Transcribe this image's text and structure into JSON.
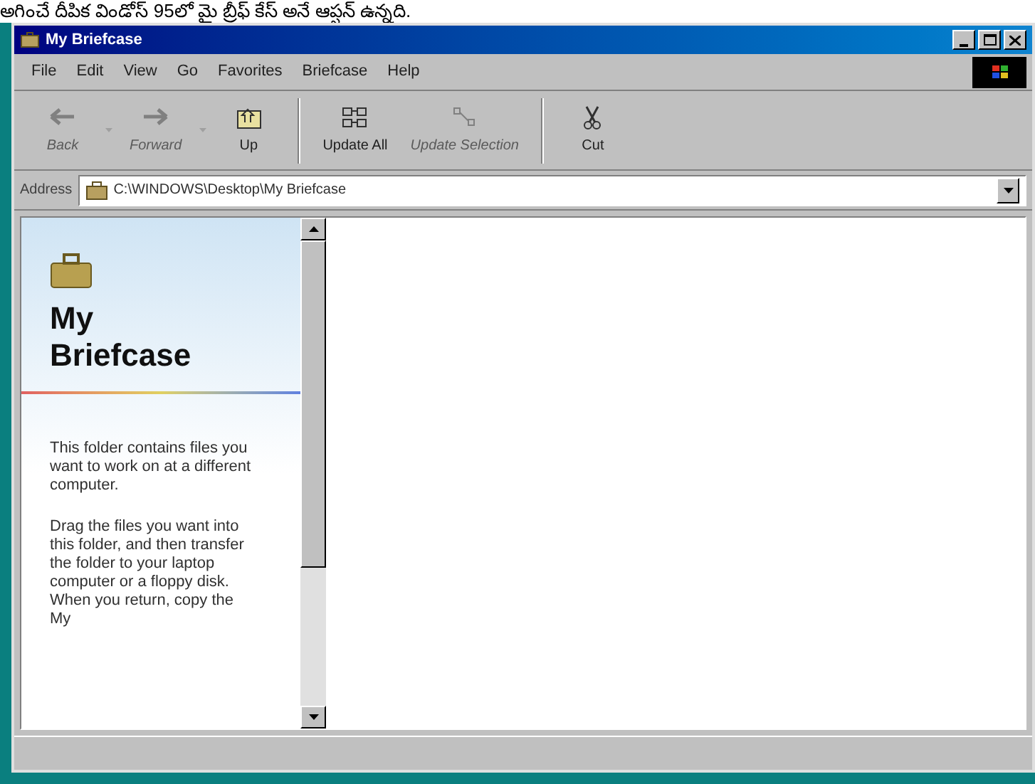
{
  "caption": "అగించే దీపిక విండోస్ 95లో మై బ్రీఫ్ కేస్ అనే ఆప్షన్ ఉన్నది.",
  "window": {
    "title": "My Briefcase"
  },
  "menu": [
    "File",
    "Edit",
    "View",
    "Go",
    "Favorites",
    "Briefcase",
    "Help"
  ],
  "toolbar": [
    {
      "kind": "back",
      "label": "Back",
      "disabled": true
    },
    {
      "kind": "forward",
      "label": "Forward",
      "disabled": true
    },
    {
      "kind": "up",
      "label": "Up",
      "disabled": false
    },
    {
      "kind": "update-all",
      "label": "Update All",
      "disabled": false
    },
    {
      "kind": "update-selection",
      "label": "Update Selection",
      "disabled": true
    },
    {
      "kind": "cut",
      "label": "Cut",
      "disabled": false
    }
  ],
  "address": {
    "label": "Address",
    "value": "C:\\WINDOWS\\Desktop\\My Briefcase"
  },
  "panel": {
    "title": "My Briefcase",
    "paragraphs": [
      "This folder contains files you want to work on at a different computer.",
      "Drag the files you want into this folder, and then transfer the folder to your laptop computer or a floppy disk. When you return, copy the My"
    ]
  }
}
